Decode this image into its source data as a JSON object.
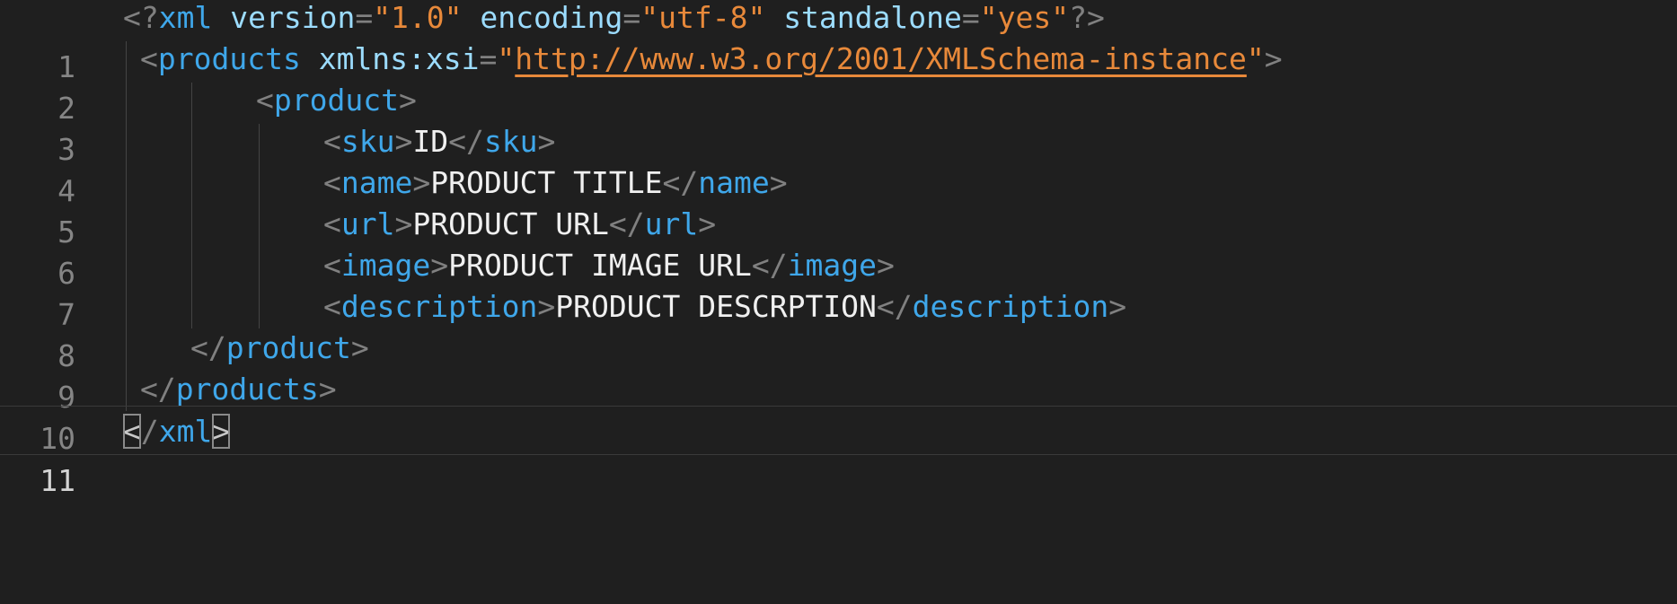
{
  "editor": {
    "lines": [
      {
        "number": "1"
      },
      {
        "number": "2"
      },
      {
        "number": "3"
      },
      {
        "number": "4"
      },
      {
        "number": "5"
      },
      {
        "number": "6"
      },
      {
        "number": "7"
      },
      {
        "number": "8"
      },
      {
        "number": "9"
      },
      {
        "number": "10"
      },
      {
        "number": "11"
      }
    ],
    "tokens": {
      "xml": "xml",
      "version": "version",
      "version_val": "\"1.0\"",
      "encoding": "encoding",
      "encoding_val": "\"utf-8\"",
      "standalone": "standalone",
      "standalone_val": "\"yes\"",
      "products": "products",
      "xmlns": "xmlns:xsi",
      "xmlns_q1": "\"",
      "xmlns_url": "http://www.w3.org/2001/XMLSchema-instance",
      "xmlns_q2": "\"",
      "product": "product",
      "sku": "sku",
      "sku_val": "ID",
      "name": "name",
      "name_val": "PRODUCT TITLE",
      "url": "url",
      "url_val": "PRODUCT URL",
      "image": "image",
      "image_val": "PRODUCT IMAGE URL",
      "description": "description",
      "description_val": "PRODUCT DESCRPTION"
    },
    "colors": {
      "background": "#1f1f1f",
      "tag": "#3fa7ea",
      "attribute": "#9cdcfe",
      "string": "#e8893a",
      "text": "#f0f0f0",
      "punctuation": "#808080"
    }
  }
}
